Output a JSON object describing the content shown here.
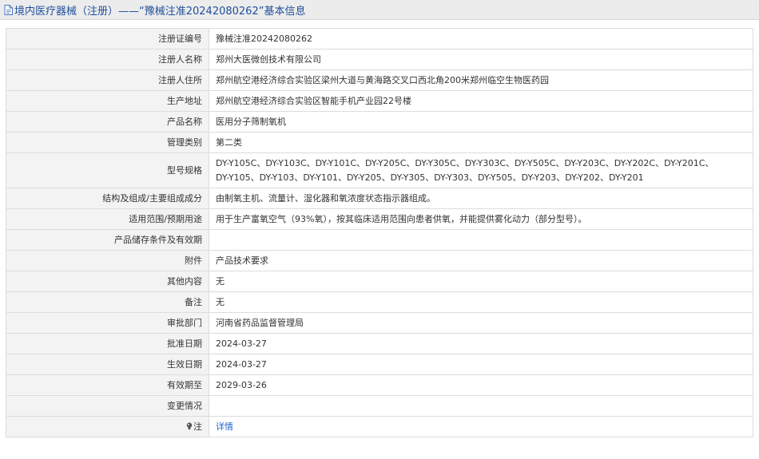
{
  "header": {
    "title": "境内医疗器械（注册）——“豫械注准20242080262”基本信息",
    "icon": "document-icon"
  },
  "rows": [
    {
      "label": "注册证编号",
      "value": "豫械注准20242080262"
    },
    {
      "label": "注册人名称",
      "value": "郑州大医微创技术有限公司"
    },
    {
      "label": "注册人住所",
      "value": "郑州航空港经济综合实验区梁州大道与黄海路交叉口西北角200米郑州临空生物医药园"
    },
    {
      "label": "生产地址",
      "value": "郑州航空港经济综合实验区智能手机产业园22号楼"
    },
    {
      "label": "产品名称",
      "value": "医用分子筛制氧机"
    },
    {
      "label": "管理类别",
      "value": "第二类"
    },
    {
      "label": "型号规格",
      "value_line1": "DY-Y105C、DY-Y103C、DY-Y101C、DY-Y205C、DY-Y305C、DY-Y303C、DY-Y505C、DY-Y203C、DY-Y202C、DY-Y201C、",
      "value_line2": "DY-Y105、DY-Y103、DY-Y101、DY-Y205、DY-Y305、DY-Y303、DY-Y505、DY-Y203、DY-Y202、DY-Y201"
    },
    {
      "label": "结构及组成/主要组成成分",
      "value": "由制氧主机、流量计、湿化器和氧浓度状态指示器组成。"
    },
    {
      "label": "适用范围/预期用途",
      "value": "用于生产富氧空气（93%氧），按其临床适用范围向患者供氧，并能提供雾化动力（部分型号）。"
    },
    {
      "label": "产品储存条件及有效期",
      "value": ""
    },
    {
      "label": "附件",
      "value": "产品技术要求"
    },
    {
      "label": "其他内容",
      "value": "无"
    },
    {
      "label": "备注",
      "value": "无"
    },
    {
      "label": "审批部门",
      "value": "河南省药品监督管理局"
    },
    {
      "label": "批准日期",
      "value": "2024-03-27"
    },
    {
      "label": "生效日期",
      "value": "2024-03-27"
    },
    {
      "label": "有效期至",
      "value": "2029-03-26"
    },
    {
      "label": "变更情况",
      "value": ""
    },
    {
      "label": "注",
      "label_icon": "lightbulb-icon",
      "value": "详情"
    }
  ],
  "colors": {
    "title": "#1f4e9b",
    "link": "#1f64c8",
    "label_bg": "#f3f3f3",
    "border": "#dcdcdc",
    "header_bg": "#ececec"
  }
}
